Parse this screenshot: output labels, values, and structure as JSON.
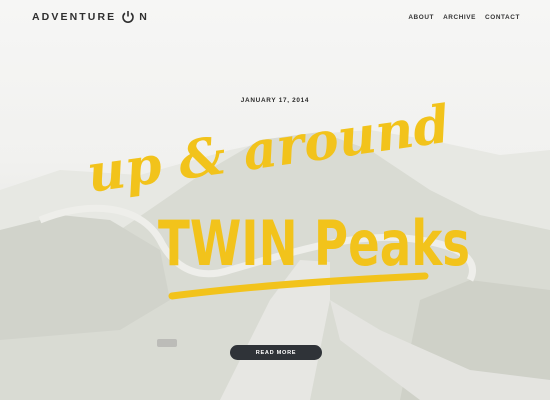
{
  "site": {
    "logo_prefix": "ADVENTURE ",
    "logo_suffix": "N",
    "icons": {
      "logo_mark": "power-icon"
    }
  },
  "nav": {
    "items": [
      {
        "label": "ABOUT"
      },
      {
        "label": "ARCHIVE"
      },
      {
        "label": "CONTACT"
      }
    ]
  },
  "post": {
    "date": "JANUARY 17, 2014",
    "title_line1": "up & around",
    "title_line2": "TWIN Peaks",
    "read_more_label": "READ MORE"
  },
  "colors": {
    "accent": "#f2c31b",
    "button_bg": "#2f3338",
    "text_dark": "#2e2e2e"
  }
}
